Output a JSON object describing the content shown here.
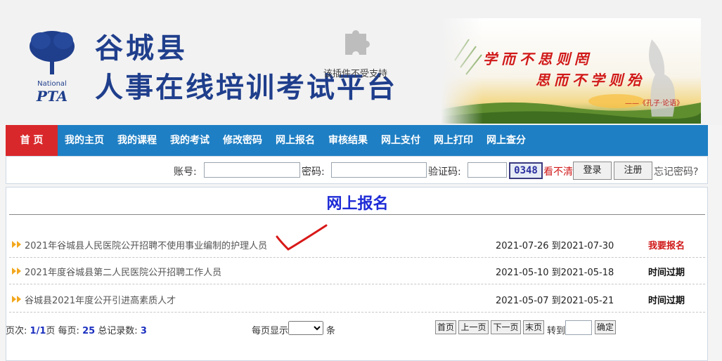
{
  "header": {
    "county": "谷城县",
    "platform": "人事在线培训考试平台",
    "plugin_notice": "该插件不受支持",
    "logo_top": "National",
    "logo_bottom": "PTA",
    "banner_line1": "学而不思则罔",
    "banner_line2": "思而不学则殆",
    "banner_sign": "——《孔子·论语》"
  },
  "nav": {
    "items": [
      "首 页",
      "我的主页",
      "我的课程",
      "我的考试",
      "修改密码",
      "网上报名",
      "审核结果",
      "网上支付",
      "网上打印",
      "网上查分"
    ]
  },
  "login": {
    "account_label": "账号:",
    "account_value": "",
    "password_label": "密码:",
    "password_value": "",
    "captcha_label": "验证码:",
    "captcha_value": "",
    "captcha_code": "0348",
    "unclear_label": "看不清",
    "login_button": "登录",
    "register_button": "注册",
    "forgot_label": "忘记密码?"
  },
  "section": {
    "title": "网上报名"
  },
  "registrations": [
    {
      "title": "2021年谷城县人民医院公开招聘不使用事业编制的护理人员",
      "dates": "2021-07-26 到2021-07-30",
      "status": "我要报名",
      "open": true
    },
    {
      "title": "2021年度谷城县第二人民医院公开招聘工作人员",
      "dates": "2021-05-10 到2021-05-18",
      "status": "时间过期",
      "open": false
    },
    {
      "title": "谷城县2021年度公开引进高素质人才",
      "dates": "2021-05-07 到2021-05-21",
      "status": "时间过期",
      "open": false
    }
  ],
  "pager": {
    "page_label": "页次:",
    "page_value": "1/1",
    "page_suffix": "页",
    "per_page_label": "每页:",
    "per_page_value": "25",
    "total_label": "总记录数:",
    "total_value": "3",
    "show_label": "每页显示",
    "show_select": "",
    "show_suffix": "条",
    "first": "首页",
    "prev": "上一页",
    "next": "下一页",
    "last": "末页",
    "goto_label": "转到",
    "goto_value": "",
    "confirm": "确定"
  },
  "colors": {
    "nav_bg": "#1e7fc4",
    "nav_home": "#d9282b",
    "title_blue": "#1e2bd6",
    "status_open": "#d01818",
    "title_dark_blue": "#1f3e8c"
  }
}
